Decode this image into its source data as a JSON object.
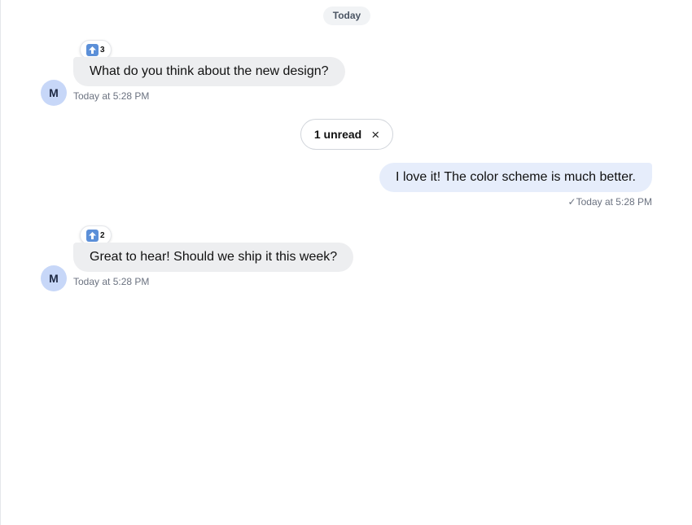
{
  "date_divider": "Today",
  "unread_banner": {
    "label": "1 unread",
    "close_icon": "×"
  },
  "messages": [
    {
      "direction": "incoming",
      "avatar": "M",
      "text": "What do you think about the new design?",
      "timestamp": "Today at 5:28 PM",
      "reaction": {
        "icon": "up-arrow-emoji",
        "count": "3"
      }
    },
    {
      "direction": "outgoing",
      "text": "I love it! The color scheme is much better.",
      "status_icon": "✓",
      "timestamp": "Today at 5:28 PM"
    },
    {
      "direction": "incoming",
      "avatar": "M",
      "text": "Great to hear! Should we ship it this week?",
      "timestamp": "Today at 5:28 PM",
      "reaction": {
        "icon": "up-arrow-emoji",
        "count": "2"
      }
    }
  ],
  "colors": {
    "incoming_bubble": "#edeef0",
    "outgoing_bubble": "#e6edfb",
    "avatar_bg": "#c7d7f8",
    "emoji_bg": "#5b8fd8"
  }
}
